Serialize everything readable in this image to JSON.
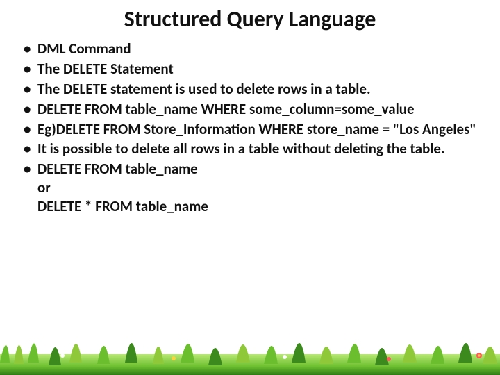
{
  "title": "Structured Query Language",
  "bullets": {
    "b0": "DML  Command",
    "b1": "The DELETE Statement",
    "b2": "The DELETE statement is used to delete rows in a table.",
    "b3": "DELETE FROM table_name WHERE some_column=some_value",
    "b4": "Eg)DELETE FROM Store_Information WHERE store_name = \"Los Angeles\"",
    "b5": "It is possible to delete all rows in a table without deleting the table.",
    "b6": "DELETE FROM table_name\nor\nDELETE * FROM table_name"
  },
  "colors": {
    "highlight_border": "#3a7a1f",
    "highlight_fill_top": "#f6fbe3",
    "highlight_fill_bottom": "#e0eec0",
    "grass_light": "#8fc93a",
    "grass_dark": "#3c8a1e"
  }
}
